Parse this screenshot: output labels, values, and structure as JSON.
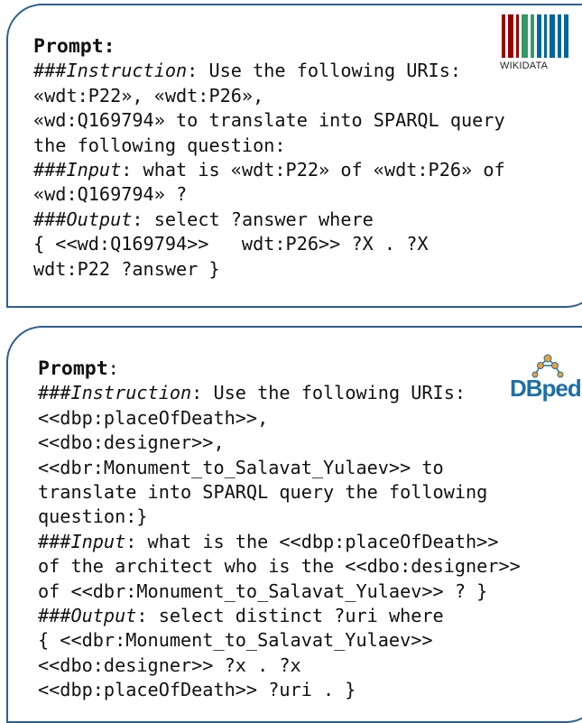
{
  "cards": [
    {
      "prompt_label": "Prompt:",
      "logo_text": "WIKIDATA",
      "lines": [
        "«wdt:P22», «wdt:P26»,",
        "«wd:Q169794» to translate into SPARQL query",
        "the following question:"
      ],
      "instruction": {
        "prefix": "###",
        "keyword": "Instruction",
        "rest": ": Use the following URIs:"
      },
      "input": {
        "prefix": "###",
        "keyword": "Input",
        "rest": ": what is «wdt:P22» of «wdt:P26» of"
      },
      "input_cont": "«wd:Q169794» ?",
      "output": {
        "prefix": "###",
        "keyword": "Output",
        "rest": ": select ?answer where"
      },
      "output_lines": [
        "{ <<wd:Q169794>>   wdt:P26>> ?X . ?X",
        "wdt:P22 ?answer }"
      ]
    },
    {
      "prompt_label": "Prompt",
      "prompt_colon": ":",
      "logo_text": "DBpedia",
      "instruction": {
        "prefix": "###",
        "keyword": "Instruction",
        "rest": ": Use the following URIs:"
      },
      "lines": [
        "<<dbp:placeOfDeath>>,",
        "<<dbo:designer>>,",
        "<<dbr:Monument_to_Salavat_Yulaev>> to",
        "translate into SPARQL query the following",
        "question:}"
      ],
      "input": {
        "prefix": "###",
        "keyword": "Input",
        "rest": ": what is the <<dbp:placeOfDeath>>"
      },
      "input_lines": [
        "of the architect who is the <<dbo:designer>>",
        "of <<dbr:Monument_to_Salavat_Yulaev>> ? }"
      ],
      "output": {
        "prefix": "###",
        "keyword": "Output",
        "rest": ": select distinct ?uri where"
      },
      "output_lines": [
        "{ <<dbr:Monument_to_Salavat_Yulaev>>",
        "<<dbo:designer>> ?x . ?x",
        "<<dbp:placeOfDeath>> ?uri . }"
      ]
    }
  ],
  "colors": {
    "border": "#2e5e8e",
    "wikidata_bars": [
      "#990000",
      "#339966",
      "#006699"
    ],
    "dbpedia_blue": "#1d6fa8",
    "dbpedia_dots": "#f0a030"
  }
}
